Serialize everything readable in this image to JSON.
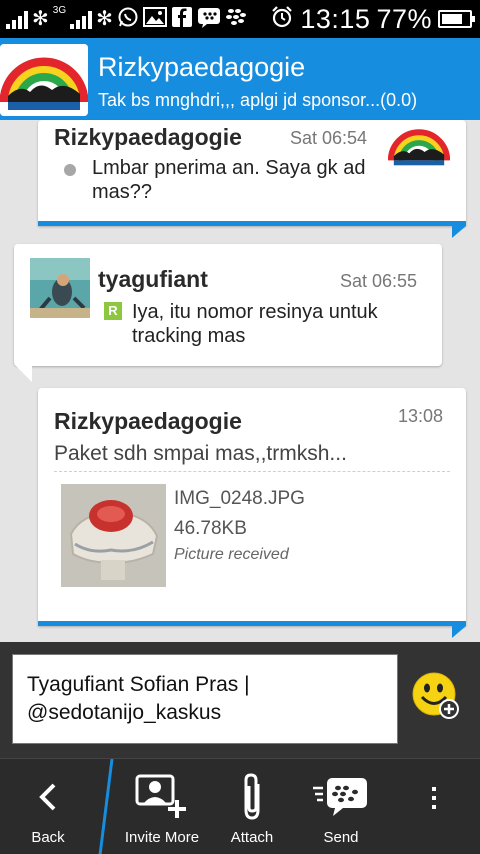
{
  "status_bar": {
    "time": "13:15",
    "battery_pct": "77%",
    "battery_level": 0.77,
    "network_label": "3G"
  },
  "header": {
    "title": "Rizkypaedagogie",
    "subtitle": "Tak bs mnghdri,,, aplgi jd sponsor...(0.0)"
  },
  "messages": [
    {
      "sender": "Rizkypaedagogie",
      "time": "Sat 06:54",
      "text": "Lmbar pnerima an. Saya gk ad mas??"
    },
    {
      "sender": "tyagufiant",
      "time": "Sat 06:55",
      "badge": "R",
      "text": "Iya, itu nomor resinya untuk tracking mas"
    },
    {
      "sender": "Rizkypaedagogie",
      "time": "13:08",
      "text": "Paket sdh smpai mas,,trmksh...",
      "attachment": {
        "file_name": "IMG_0248.JPG",
        "file_size": "46.78KB",
        "status": "Picture received"
      }
    }
  ],
  "compose": {
    "text": "Tyagufiant Sofian Pras | @sedotanijo_kaskus"
  },
  "toolbar": {
    "back": "Back",
    "invite": "Invite More",
    "attach": "Attach",
    "send": "Send"
  },
  "colors": {
    "accent": "#168dde",
    "background": "#e4e4e4",
    "toolbar": "#2b2b2b"
  }
}
